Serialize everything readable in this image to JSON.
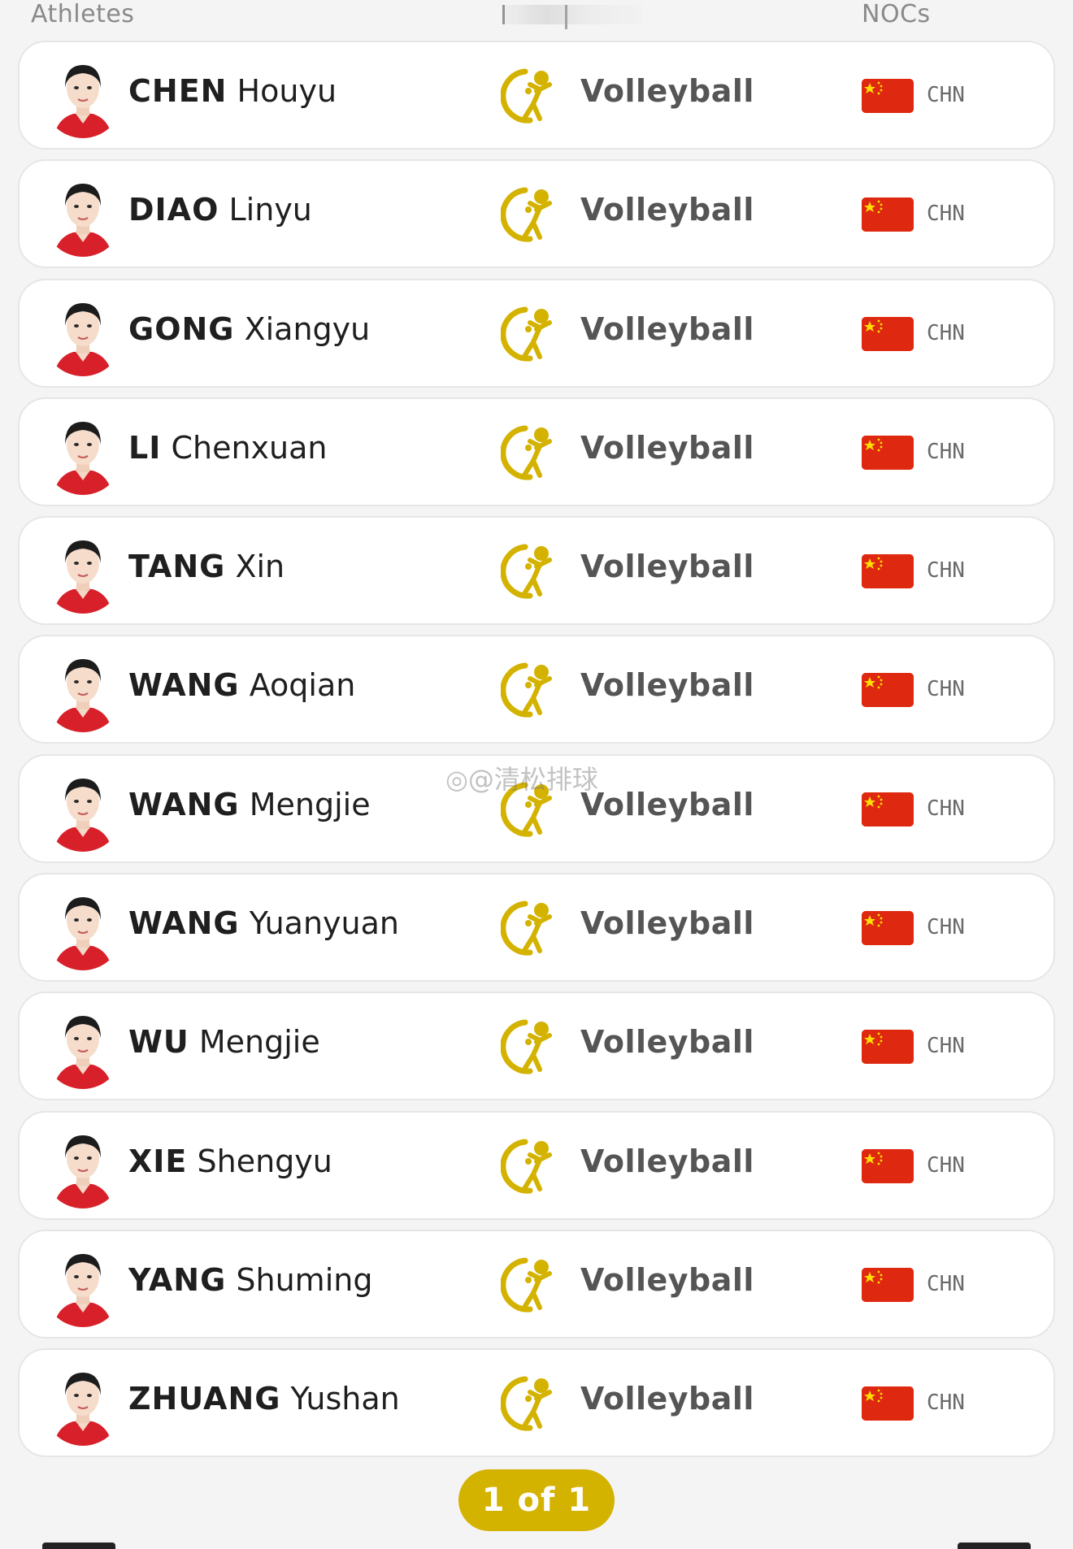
{
  "header": {
    "athletes_label": "Athletes",
    "nocs_label": "NOCs"
  },
  "accent_color": "#d4b200",
  "flag_color": "#de2910",
  "athletes": [
    {
      "surname": "CHEN",
      "given": "Houyu",
      "sport": "Volleyball",
      "noc": "CHN",
      "sport_icon": "volleyball-pictogram",
      "flag": "china-flag"
    },
    {
      "surname": "DIAO",
      "given": "Linyu",
      "sport": "Volleyball",
      "noc": "CHN",
      "sport_icon": "volleyball-pictogram",
      "flag": "china-flag"
    },
    {
      "surname": "GONG",
      "given": "Xiangyu",
      "sport": "Volleyball",
      "noc": "CHN",
      "sport_icon": "volleyball-pictogram",
      "flag": "china-flag"
    },
    {
      "surname": "LI",
      "given": "Chenxuan",
      "sport": "Volleyball",
      "noc": "CHN",
      "sport_icon": "volleyball-pictogram",
      "flag": "china-flag"
    },
    {
      "surname": "TANG",
      "given": "Xin",
      "sport": "Volleyball",
      "noc": "CHN",
      "sport_icon": "volleyball-pictogram",
      "flag": "china-flag"
    },
    {
      "surname": "WANG",
      "given": "Aoqian",
      "sport": "Volleyball",
      "noc": "CHN",
      "sport_icon": "volleyball-pictogram",
      "flag": "china-flag"
    },
    {
      "surname": "WANG",
      "given": "Mengjie",
      "sport": "Volleyball",
      "noc": "CHN",
      "sport_icon": "volleyball-pictogram",
      "flag": "china-flag"
    },
    {
      "surname": "WANG",
      "given": "Yuanyuan",
      "sport": "Volleyball",
      "noc": "CHN",
      "sport_icon": "volleyball-pictogram",
      "flag": "china-flag"
    },
    {
      "surname": "WU",
      "given": "Mengjie",
      "sport": "Volleyball",
      "noc": "CHN",
      "sport_icon": "volleyball-pictogram",
      "flag": "china-flag"
    },
    {
      "surname": "XIE",
      "given": "Shengyu",
      "sport": "Volleyball",
      "noc": "CHN",
      "sport_icon": "volleyball-pictogram",
      "flag": "china-flag"
    },
    {
      "surname": "YANG",
      "given": "Shuming",
      "sport": "Volleyball",
      "noc": "CHN",
      "sport_icon": "volleyball-pictogram",
      "flag": "china-flag"
    },
    {
      "surname": "ZHUANG",
      "given": "Yushan",
      "sport": "Volleyball",
      "noc": "CHN",
      "sport_icon": "volleyball-pictogram",
      "flag": "china-flag"
    }
  ],
  "watermark": "@清松排球",
  "pagination": {
    "label": "1 of 1"
  }
}
